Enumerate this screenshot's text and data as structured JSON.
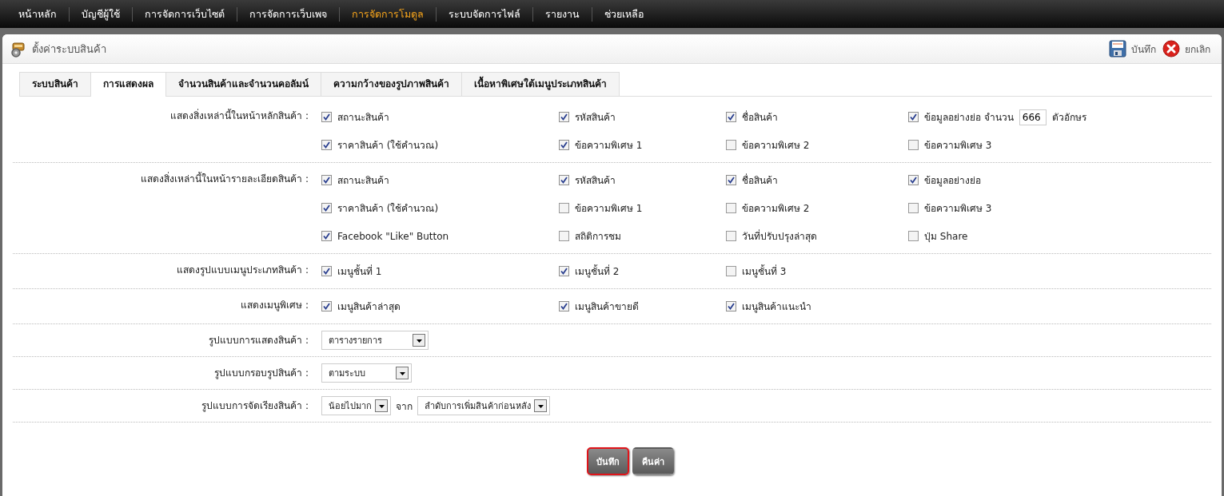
{
  "nav": [
    {
      "label": "หน้าหลัก",
      "selected": false
    },
    {
      "label": "บัญชีผู้ใช้",
      "selected": false
    },
    {
      "label": "การจัดการเว็บไซต์",
      "selected": false
    },
    {
      "label": "การจัดการเว็บเพจ",
      "selected": false
    },
    {
      "label": "การจัดการโมดูล",
      "selected": true
    },
    {
      "label": "ระบบจัดการไฟล์",
      "selected": false
    },
    {
      "label": "รายงาน",
      "selected": false
    },
    {
      "label": "ช่วยเหลือ",
      "selected": false
    }
  ],
  "header": {
    "title": "ตั้งค่าระบบสินค้า",
    "actions": [
      {
        "label": "บันทึก",
        "kind": "save"
      },
      {
        "label": "ยกเลิก",
        "kind": "cancel"
      }
    ]
  },
  "tabs": [
    {
      "label": "ระบบสินค้า",
      "selected": false
    },
    {
      "label": "การแสดงผล",
      "selected": true
    },
    {
      "label": "จำนวนสินค้าและจำนวนคอลัมน์",
      "selected": false
    },
    {
      "label": "ความกว้างของรูปภาพสินค้า",
      "selected": false
    },
    {
      "label": "เนื้อหาพิเศษใต้เมนูประเภทสินค้า",
      "selected": false
    }
  ],
  "rows": [
    {
      "label": "แสดงสิ่งเหล่านี้ในหน้าหลักสินค้า :",
      "kind": "checks",
      "options": [
        {
          "label": "สถานะสินค้า",
          "checked": true
        },
        {
          "label": "รหัสสินค้า",
          "checked": true
        },
        {
          "label": "ชื่อสินค้า",
          "checked": true
        },
        {
          "label": "ข้อมูลอย่างย่อ จำนวน",
          "checked": true,
          "value": "666",
          "suffix": "ตัวอักษร"
        },
        {
          "label": "ราคาสินค้า (ใช้คำนวณ)",
          "checked": true
        },
        {
          "label": "ข้อความพิเศษ 1",
          "checked": true
        },
        {
          "label": "ข้อความพิเศษ 2",
          "checked": false
        },
        {
          "label": "ข้อความพิเศษ 3",
          "checked": false
        }
      ]
    },
    {
      "label": "แสดงสิ่งเหล่านี้ในหน้ารายละเอียดสินค้า :",
      "kind": "checks",
      "options": [
        {
          "label": "สถานะสินค้า",
          "checked": true
        },
        {
          "label": "รหัสสินค้า",
          "checked": true
        },
        {
          "label": "ชื่อสินค้า",
          "checked": true
        },
        {
          "label": "ข้อมูลอย่างย่อ",
          "checked": true
        },
        {
          "label": "ราคาสินค้า (ใช้คำนวณ)",
          "checked": true
        },
        {
          "label": "ข้อความพิเศษ 1",
          "checked": false
        },
        {
          "label": "ข้อความพิเศษ 2",
          "checked": false
        },
        {
          "label": "ข้อความพิเศษ 3",
          "checked": false
        },
        {
          "label": "Facebook \"Like\" Button",
          "checked": true
        },
        {
          "label": "สถิติการชม",
          "checked": false
        },
        {
          "label": "วันที่ปรับปรุงล่าสุด",
          "checked": false
        },
        {
          "label": "ปุ่ม Share",
          "checked": false
        }
      ]
    },
    {
      "label": "แสดงรูปแบบเมนูประเภทสินค้า :",
      "kind": "checks",
      "options": [
        {
          "label": "เมนูชั้นที่ 1",
          "checked": true
        },
        {
          "label": "เมนูชั้นที่ 2",
          "checked": true
        },
        {
          "label": "เมนูชั้นที่ 3",
          "checked": false
        }
      ]
    },
    {
      "label": "แสดงเมนูพิเศษ :",
      "kind": "checks",
      "options": [
        {
          "label": "เมนูสินค้าล่าสุด",
          "checked": true
        },
        {
          "label": "เมนูสินค้าขายดี",
          "checked": true
        },
        {
          "label": "เมนูสินค้าแนะนำ",
          "checked": true
        }
      ]
    },
    {
      "label": "รูปแบบการแสดงสินค้า :",
      "kind": "selects",
      "controls": [
        {
          "kind": "select",
          "value": "ตารางรายการ"
        }
      ]
    },
    {
      "label": "รูปแบบกรอบรูปสินค้า :",
      "kind": "selects",
      "controls": [
        {
          "kind": "select",
          "value": "ตามระบบ"
        }
      ]
    },
    {
      "label": "รูปแบบการจัดเรียงสินค้า :",
      "kind": "selects",
      "controls": [
        {
          "kind": "select",
          "value": "น้อยไปมาก"
        },
        {
          "kind": "text",
          "text": "จาก"
        },
        {
          "kind": "select",
          "value": "ลำดับการเพิ่มสินค้าก่อนหลัง"
        }
      ]
    }
  ],
  "buttons": [
    {
      "label": "บันทึก",
      "focused": true
    },
    {
      "label": "คืนค่า",
      "focused": false
    }
  ]
}
